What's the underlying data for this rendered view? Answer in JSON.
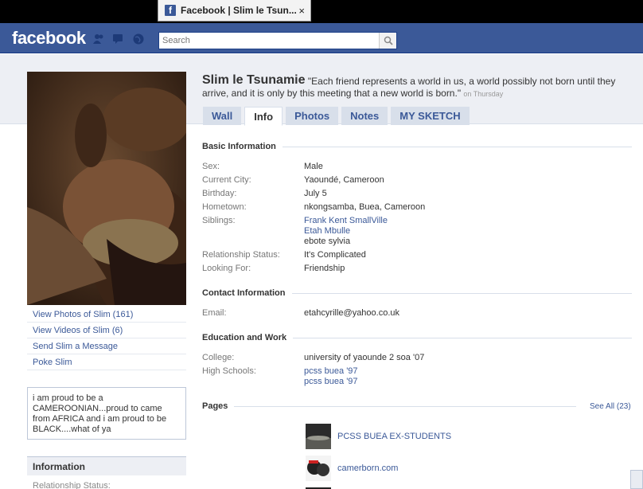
{
  "browser": {
    "tab_title": "Facebook | Slim le Tsun...",
    "tab_close": "×",
    "favicon": "f"
  },
  "header": {
    "logo": "facebook",
    "search_placeholder": "Search"
  },
  "profile": {
    "name": "Slim le Tsunamie",
    "status_text": "\"Each friend represents a world in us, a world possibly not born until they arrive, and it is only by this meeting that a new world is born.\"",
    "status_time": "on Thursday"
  },
  "tabs": [
    "Wall",
    "Info",
    "Photos",
    "Notes",
    "MY SKETCH"
  ],
  "left": {
    "links": [
      "View Photos of Slim (161)",
      "View Videos of Slim (6)",
      "Send Slim a Message",
      "Poke Slim"
    ],
    "bio": "i am proud to be a CAMEROONIAN...proud to came from AFRICA and i am proud to be BLACK....what of ya",
    "info_header": "Information",
    "info_sub": "Relationship Status:"
  },
  "basic": {
    "title": "Basic Information",
    "sex": {
      "label": "Sex:",
      "value": "Male"
    },
    "city": {
      "label": "Current City:",
      "value": "Yaoundé, Cameroon"
    },
    "birthday": {
      "label": "Birthday:",
      "value": "July 5"
    },
    "hometown": {
      "label": "Hometown:",
      "value": "nkongsamba, Buea, Cameroon"
    },
    "siblings": {
      "label": "Siblings:",
      "values": [
        "Frank Kent SmallVille",
        "Etah Mbulle",
        "ebote sylvia"
      ]
    },
    "relationship": {
      "label": "Relationship Status:",
      "value": "It's Complicated"
    },
    "looking": {
      "label": "Looking For:",
      "value": "Friendship"
    }
  },
  "contact": {
    "title": "Contact Information",
    "email": {
      "label": "Email:",
      "value": "etahcyrille@yahoo.co.uk"
    }
  },
  "education": {
    "title": "Education and Work",
    "college": {
      "label": "College:",
      "value": "university of yaounde 2 soa '07"
    },
    "high_schools": {
      "label": "High Schools:",
      "values": [
        "pcss buea '97",
        "pcss buea '97"
      ]
    }
  },
  "pages": {
    "title": "Pages",
    "see_all": "See All (23)",
    "items": [
      "PCSS BUEA EX-STUDENTS",
      "camerborn.com"
    ]
  }
}
